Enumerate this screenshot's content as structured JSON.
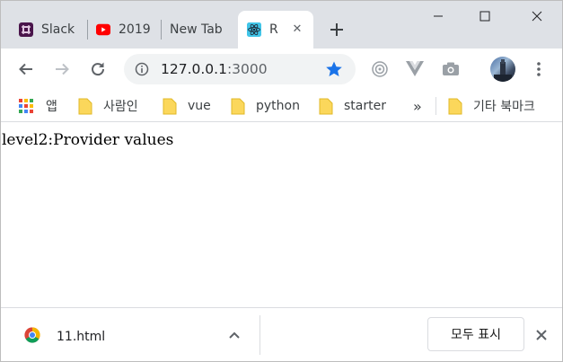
{
  "tabs": [
    {
      "title": "Slack",
      "icon": "slack-icon"
    },
    {
      "title": "2019",
      "icon": "youtube-icon"
    },
    {
      "title": "New Tab",
      "icon": "none"
    },
    {
      "title": "R",
      "icon": "react-icon",
      "active": true
    }
  ],
  "toolbar": {
    "url_host": "127.0.0.1",
    "url_port": ":3000"
  },
  "bookmarks": [
    {
      "label": "앱",
      "icon": "apps-grid-icon"
    },
    {
      "label": "사람인",
      "icon": "folder-icon"
    },
    {
      "label": "vue",
      "icon": "folder-icon"
    },
    {
      "label": "python",
      "icon": "folder-icon"
    },
    {
      "label": "starter",
      "icon": "folder-icon"
    },
    {
      "label": "»",
      "icon": "more-bookmarks-icon"
    },
    {
      "label": "기타 북마크",
      "icon": "folder-icon"
    }
  ],
  "content": {
    "text": "level2:Provider values"
  },
  "downloads": {
    "file_name": "11.html",
    "show_all_label": "모두 표시"
  },
  "colors": {
    "tabstrip": "#dee1e6",
    "accent_star": "#1a73e8",
    "folder": "#fbd75b"
  }
}
